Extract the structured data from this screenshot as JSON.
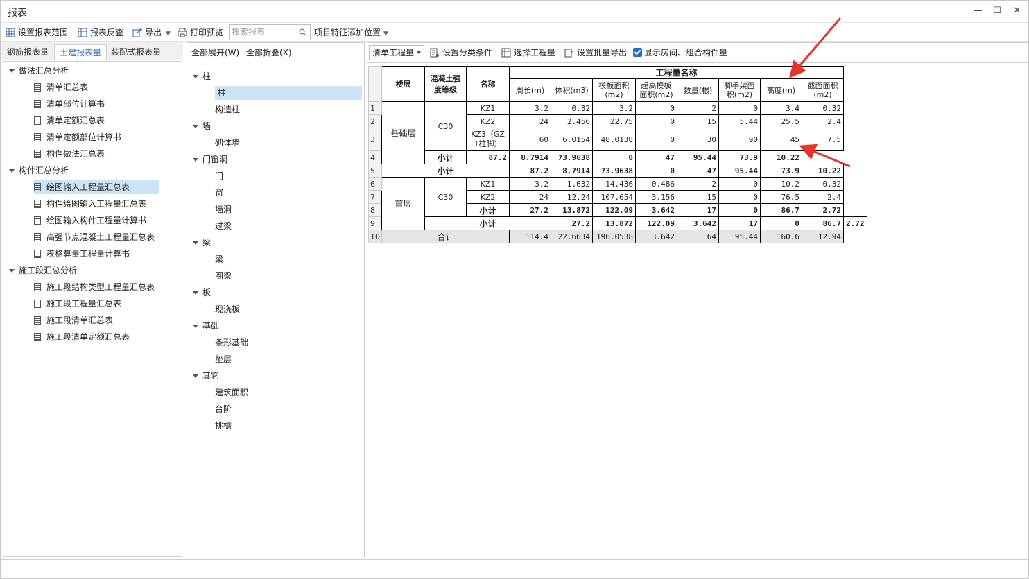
{
  "window": {
    "title": "报表",
    "controls": [
      "—",
      "☐",
      "✕"
    ]
  },
  "toolbar": {
    "set_range": "设置报表范围",
    "check": "报表反查",
    "export": "导出",
    "print": "打印预览",
    "search_placeholder": "搜索报表",
    "add_feature": "项目特征添加位置"
  },
  "tabs": [
    "钢筋报表量",
    "土建报表量",
    "装配式报表量"
  ],
  "left_tree": [
    {
      "label": "做法汇总分析",
      "level": 0
    },
    {
      "label": "清单汇总表",
      "level": 1
    },
    {
      "label": "清单部位计算书",
      "level": 1
    },
    {
      "label": "清单定额汇总表",
      "level": 1
    },
    {
      "label": "清单定额部位计算书",
      "level": 1
    },
    {
      "label": "构件做法汇总表",
      "level": 1
    },
    {
      "label": "构件汇总分析",
      "level": 0
    },
    {
      "label": "绘图输入工程量汇总表",
      "level": 1,
      "selected": true
    },
    {
      "label": "构件绘图输入工程量汇总表",
      "level": 1
    },
    {
      "label": "绘图输入构件工程量计算书",
      "level": 1
    },
    {
      "label": "高强节点混凝土工程量汇总表",
      "level": 1
    },
    {
      "label": "表格算量工程量计算书",
      "level": 1
    },
    {
      "label": "施工段汇总分析",
      "level": 0
    },
    {
      "label": "施工段结构类型工程量汇总表",
      "level": 1
    },
    {
      "label": "施工段工程量汇总表",
      "level": 1
    },
    {
      "label": "施工段清单汇总表",
      "level": 1
    },
    {
      "label": "施工段清单定额汇总表",
      "level": 1
    }
  ],
  "mid_toolbar": {
    "expand": "全部展开(W)",
    "collapse": "全部折叠(X)"
  },
  "mid_tree": [
    {
      "label": "柱",
      "level": 0
    },
    {
      "label": "柱",
      "level": 1,
      "selected": true
    },
    {
      "label": "构造柱",
      "level": 1
    },
    {
      "label": "墙",
      "level": 0
    },
    {
      "label": "砌体墙",
      "level": 1
    },
    {
      "label": "门窗洞",
      "level": 0
    },
    {
      "label": "门",
      "level": 1
    },
    {
      "label": "窗",
      "level": 1
    },
    {
      "label": "墙洞",
      "level": 1
    },
    {
      "label": "过梁",
      "level": 1
    },
    {
      "label": "梁",
      "level": 0
    },
    {
      "label": "梁",
      "level": 1
    },
    {
      "label": "圈梁",
      "level": 1
    },
    {
      "label": "板",
      "level": 0
    },
    {
      "label": "现浇板",
      "level": 1
    },
    {
      "label": "基础",
      "level": 0
    },
    {
      "label": "条形基础",
      "level": 1
    },
    {
      "label": "垫层",
      "level": 1
    },
    {
      "label": "其它",
      "level": 0
    },
    {
      "label": "建筑面积",
      "level": 1
    },
    {
      "label": "台阶",
      "level": 1
    },
    {
      "label": "挑檐",
      "level": 1
    }
  ],
  "right_toolbar": {
    "combo": "清单工程量",
    "classify": "设置分类条件",
    "select": "选择工程量",
    "batch": "设置批量导出",
    "show_rooms": "显示房间、组合构件量"
  },
  "table": {
    "h_floor": "楼层",
    "h_grade": "混凝土强度等级",
    "h_name": "名称",
    "h_group": "工程量名称",
    "columns": [
      "周长(m)",
      "体积(m3)",
      "模板面积(m2)",
      "超高模板面积(m2)",
      "数量(根)",
      "脚手架面积(m2)",
      "高度(m)",
      "截面面积(m2)"
    ],
    "floor1": "基础层",
    "floor2": "首层",
    "grade": "C30",
    "subtotal": "小计",
    "total": "合计",
    "rownums": [
      "1",
      "2",
      "3",
      "4",
      "5",
      "6",
      "7",
      "8",
      "9",
      "10"
    ],
    "r1": {
      "name": "KZ1",
      "v": [
        "3.2",
        "0.32",
        "3.2",
        "0",
        "2",
        "0",
        "3.4",
        "0.32"
      ]
    },
    "r2": {
      "name": "KZ2",
      "v": [
        "24",
        "2.456",
        "22.75",
        "0",
        "15",
        "5.44",
        "25.5",
        "2.4"
      ]
    },
    "r3": {
      "name": "KZ3（GZ1柱脚）",
      "v": [
        "60",
        "6.0154",
        "48.0138",
        "0",
        "30",
        "90",
        "45",
        "7.5"
      ]
    },
    "r4": {
      "v": [
        "87.2",
        "8.7914",
        "73.9638",
        "0",
        "47",
        "95.44",
        "73.9",
        "10.22"
      ]
    },
    "r5": {
      "v": [
        "87.2",
        "8.7914",
        "73.9638",
        "0",
        "47",
        "95.44",
        "73.9",
        "10.22"
      ]
    },
    "r6": {
      "name": "KZ1",
      "v": [
        "3.2",
        "1.632",
        "14.436",
        "0.486",
        "2",
        "0",
        "10.2",
        "0.32"
      ]
    },
    "r7": {
      "name": "KZ2",
      "v": [
        "24",
        "12.24",
        "107.654",
        "3.156",
        "15",
        "0",
        "76.5",
        "2.4"
      ]
    },
    "r8": {
      "v": [
        "27.2",
        "13.872",
        "122.09",
        "3.642",
        "17",
        "0",
        "86.7",
        "2.72"
      ]
    },
    "r9": {
      "v": [
        "27.2",
        "13.872",
        "122.09",
        "3.642",
        "17",
        "0",
        "86.7",
        "2.72"
      ]
    },
    "r10": {
      "v": [
        "114.4",
        "22.6634",
        "196.0538",
        "3.642",
        "64",
        "95.44",
        "160.6",
        "12.94"
      ]
    }
  }
}
